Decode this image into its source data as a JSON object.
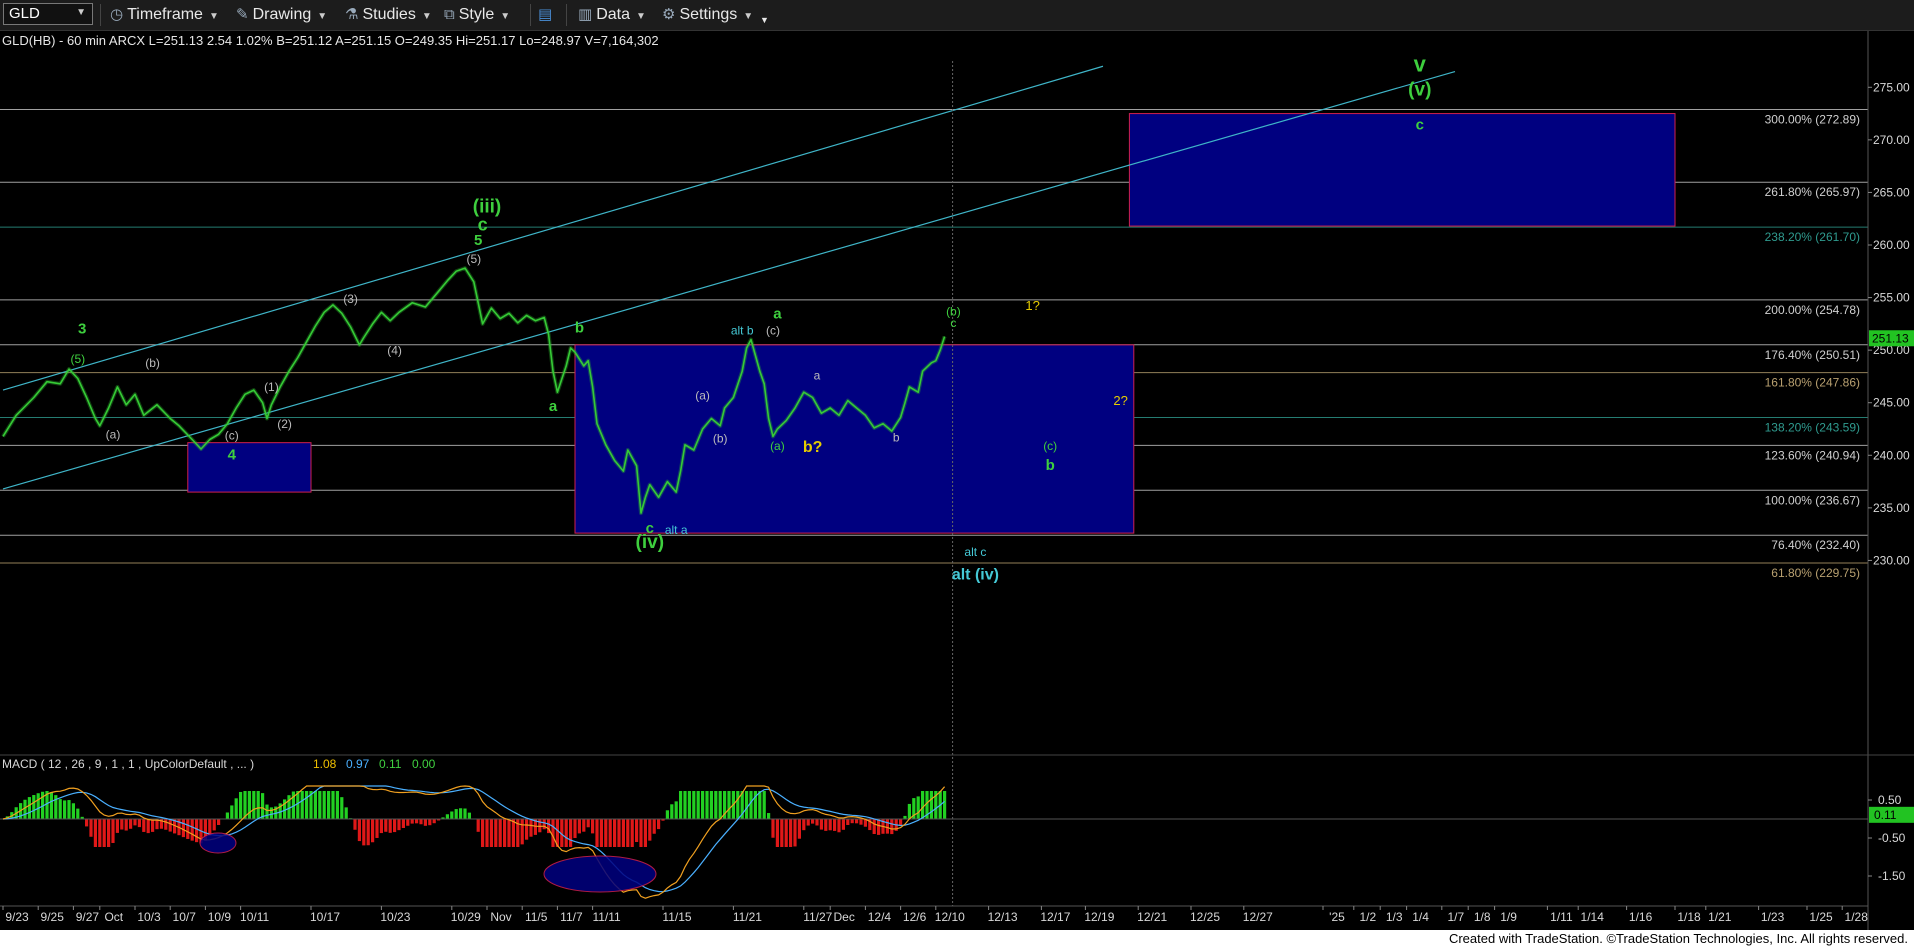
{
  "toolbar": {
    "symbol": "GLD",
    "timeframe_label": "Timeframe",
    "drawing_label": "Drawing",
    "studies_label": "Studies",
    "style_label": "Style",
    "data_label": "Data",
    "settings_label": "Settings"
  },
  "header": {
    "info": "GLD(HB) - 60 min  ARCX  L=251.13  2.54  1.02%  B=251.12  A=251.15  O=249.35  Hi=251.17  Lo=248.97  V=7,164,302"
  },
  "macd": {
    "label": "MACD ( 12 , 26 , 9 , 1 , 1 , UpColorDefault , ... )",
    "values": [
      "1.08",
      "0.97",
      "0.11",
      "0.00"
    ],
    "colors": [
      "#f0c000",
      "#4ab0ff",
      "#40d040",
      "#40d040"
    ],
    "axis_ticks": [
      {
        "value": 0.5,
        "label": "0.50"
      },
      {
        "value": -0.5,
        "label": "-0.50"
      },
      {
        "value": -1.5,
        "label": "-1.50"
      }
    ],
    "current_value_label": "0.11"
  },
  "chart_data": {
    "type": "line",
    "title": "GLD(HB) - 60 min",
    "ylim": [
      225,
      277.5
    ],
    "last_price": 251.13,
    "last_price_label": "251.13",
    "y_ticks": [
      {
        "value": 275,
        "label": "275.00"
      },
      {
        "value": 270,
        "label": "270.00"
      },
      {
        "value": 265,
        "label": "265.00"
      },
      {
        "value": 260,
        "label": "260.00"
      },
      {
        "value": 255,
        "label": "255.00"
      },
      {
        "value": 250,
        "label": "250.00"
      },
      {
        "value": 245,
        "label": "245.00"
      },
      {
        "value": 240,
        "label": "240.00"
      },
      {
        "value": 235,
        "label": "235.00"
      },
      {
        "value": 230,
        "label": "230.00"
      }
    ],
    "x_ticks": [
      {
        "i": 0,
        "label": "9/23"
      },
      {
        "i": 8,
        "label": "9/25"
      },
      {
        "i": 16,
        "label": "9/27"
      },
      {
        "i": 22,
        "label": "Oct"
      },
      {
        "i": 30,
        "label": "10/3"
      },
      {
        "i": 38,
        "label": "10/7"
      },
      {
        "i": 46,
        "label": "10/9"
      },
      {
        "i": 54,
        "label": "10/11"
      },
      {
        "i": 70,
        "label": "10/17"
      },
      {
        "i": 86,
        "label": "10/23"
      },
      {
        "i": 102,
        "label": "10/29"
      },
      {
        "i": 110,
        "label": "Nov"
      },
      {
        "i": 118,
        "label": "11/5"
      },
      {
        "i": 126,
        "label": "11/7"
      },
      {
        "i": 134,
        "label": "11/11"
      },
      {
        "i": 150,
        "label": "11/15"
      },
      {
        "i": 166,
        "label": "11/21"
      },
      {
        "i": 182,
        "label": "11/27"
      },
      {
        "i": 188,
        "label": "Dec"
      },
      {
        "i": 196,
        "label": "12/4"
      },
      {
        "i": 204,
        "label": "12/6"
      },
      {
        "i": 212,
        "label": "12/10"
      },
      {
        "i": 224,
        "label": "12/13"
      },
      {
        "i": 236,
        "label": "12/17"
      },
      {
        "i": 246,
        "label": "12/19"
      },
      {
        "i": 258,
        "label": "12/21"
      },
      {
        "i": 270,
        "label": "12/25"
      },
      {
        "i": 282,
        "label": "12/27"
      },
      {
        "i": 300,
        "label": "'25"
      },
      {
        "i": 307,
        "label": "1/2"
      },
      {
        "i": 313,
        "label": "1/3"
      },
      {
        "i": 319,
        "label": "1/4"
      },
      {
        "i": 327,
        "label": "1/7"
      },
      {
        "i": 333,
        "label": "1/8"
      },
      {
        "i": 339,
        "label": "1/9"
      },
      {
        "i": 351,
        "label": "1/11"
      },
      {
        "i": 358,
        "label": "1/14"
      },
      {
        "i": 369,
        "label": "1/16"
      },
      {
        "i": 380,
        "label": "1/18"
      },
      {
        "i": 387,
        "label": "1/21"
      },
      {
        "i": 399,
        "label": "1/23"
      },
      {
        "i": 410,
        "label": "1/25"
      },
      {
        "i": 418,
        "label": "1/28"
      }
    ],
    "price_path": [
      [
        0,
        241.8
      ],
      [
        3,
        243.8
      ],
      [
        7,
        245.5
      ],
      [
        10,
        247.0
      ],
      [
        13,
        246.8
      ],
      [
        15,
        248.2
      ],
      [
        17,
        247.3
      ],
      [
        19,
        245.5
      ],
      [
        21,
        243.5
      ],
      [
        22,
        242.8
      ],
      [
        24,
        244.5
      ],
      [
        26,
        246.5
      ],
      [
        28,
        244.8
      ],
      [
        30,
        245.8
      ],
      [
        32,
        243.8
      ],
      [
        35,
        244.8
      ],
      [
        38,
        243.5
      ],
      [
        40,
        242.8
      ],
      [
        43,
        241.5
      ],
      [
        45,
        240.6
      ],
      [
        47,
        241.5
      ],
      [
        49,
        242.0
      ],
      [
        51,
        243.0
      ],
      [
        53,
        244.5
      ],
      [
        55,
        245.8
      ],
      [
        57,
        246.2
      ],
      [
        59,
        245.0
      ],
      [
        60,
        243.5
      ],
      [
        61,
        244.8
      ],
      [
        63,
        246.5
      ],
      [
        65,
        248.0
      ],
      [
        67,
        249.3
      ],
      [
        69,
        250.8
      ],
      [
        71,
        252.3
      ],
      [
        73,
        253.6
      ],
      [
        75,
        254.3
      ],
      [
        77,
        253.5
      ],
      [
        79,
        252.2
      ],
      [
        81,
        250.5
      ],
      [
        82,
        251.2
      ],
      [
        84,
        252.5
      ],
      [
        86,
        253.6
      ],
      [
        88,
        252.8
      ],
      [
        90,
        253.6
      ],
      [
        93,
        254.5
      ],
      [
        96,
        254.1
      ],
      [
        99,
        255.6
      ],
      [
        101,
        256.6
      ],
      [
        103,
        257.5
      ],
      [
        105,
        257.8
      ],
      [
        107,
        256.5
      ],
      [
        108,
        254.5
      ],
      [
        109,
        252.5
      ],
      [
        111,
        254.0
      ],
      [
        113,
        253.0
      ],
      [
        115,
        253.5
      ],
      [
        117,
        252.6
      ],
      [
        119,
        253.3
      ],
      [
        121,
        252.8
      ],
      [
        123,
        253.1
      ],
      [
        124,
        251.5
      ],
      [
        125,
        248.0
      ],
      [
        126,
        246.0
      ],
      [
        128,
        248.5
      ],
      [
        129,
        250.2
      ],
      [
        130,
        249.8
      ],
      [
        132,
        248.5
      ],
      [
        133,
        249.0
      ],
      [
        134,
        246.5
      ],
      [
        135,
        243.0
      ],
      [
        137,
        241.0
      ],
      [
        139,
        239.5
      ],
      [
        141,
        238.5
      ],
      [
        142,
        240.5
      ],
      [
        144,
        239.0
      ],
      [
        145,
        234.5
      ],
      [
        146,
        236.0
      ],
      [
        147,
        237.2
      ],
      [
        149,
        236.0
      ],
      [
        151,
        237.5
      ],
      [
        153,
        236.5
      ],
      [
        154,
        238.5
      ],
      [
        155,
        241.0
      ],
      [
        157,
        240.5
      ],
      [
        159,
        242.5
      ],
      [
        161,
        243.5
      ],
      [
        163,
        242.8
      ],
      [
        164,
        244.5
      ],
      [
        166,
        245.5
      ],
      [
        168,
        248.0
      ],
      [
        169,
        250.2
      ],
      [
        170,
        251.0
      ],
      [
        171,
        249.5
      ],
      [
        172,
        248.0
      ],
      [
        173,
        246.8
      ],
      [
        174,
        243.5
      ],
      [
        175,
        241.8
      ],
      [
        176,
        242.5
      ],
      [
        178,
        243.3
      ],
      [
        180,
        244.5
      ],
      [
        182,
        246.0
      ],
      [
        184,
        245.5
      ],
      [
        186,
        244.0
      ],
      [
        188,
        244.5
      ],
      [
        190,
        243.8
      ],
      [
        192,
        245.2
      ],
      [
        194,
        244.5
      ],
      [
        196,
        243.8
      ],
      [
        198,
        242.6
      ],
      [
        200,
        243.0
      ],
      [
        202,
        242.3
      ],
      [
        204,
        243.6
      ],
      [
        205,
        245.0
      ],
      [
        206,
        246.5
      ],
      [
        208,
        246.0
      ],
      [
        209,
        248.0
      ],
      [
        211,
        248.8
      ],
      [
        212,
        249.0
      ],
      [
        213,
        250.0
      ],
      [
        214,
        251.3
      ]
    ],
    "channel_lines": [
      {
        "i1": 0,
        "v1": 246.2,
        "i2": 250,
        "v2": 277.0
      },
      {
        "i1": 0,
        "v1": 236.8,
        "i2": 330,
        "v2": 276.5
      }
    ],
    "fib_levels": [
      {
        "value": 272.89,
        "label": "300.00% (272.89)",
        "color": "#c8c8c8"
      },
      {
        "value": 265.97,
        "label": "261.80% (265.97)",
        "color": "#c8c8c8"
      },
      {
        "value": 261.7,
        "label": "238.20% (261.70)",
        "color": "#2f9b8f"
      },
      {
        "value": 254.78,
        "label": "200.00% (254.78)",
        "color": "#c8c8c8"
      },
      {
        "value": 250.51,
        "label": "176.40% (250.51)",
        "color": "#c8c8c8"
      },
      {
        "value": 247.86,
        "label": "161.80% (247.86)",
        "color": "#b8a070"
      },
      {
        "value": 243.59,
        "label": "138.20% (243.59)",
        "color": "#2f9b8f"
      },
      {
        "value": 240.94,
        "label": "123.60% (240.94)",
        "color": "#c8c8c8"
      },
      {
        "value": 236.67,
        "label": "100.00% (236.67)",
        "color": "#c8c8c8"
      },
      {
        "value": 232.4,
        "label": "76.40% (232.40)",
        "color": "#c8c8c8"
      },
      {
        "value": 229.75,
        "label": "61.80% (229.75)",
        "color": "#b8a070"
      }
    ],
    "target_boxes": [
      {
        "i1": 42,
        "i2": 70,
        "top": 241.2,
        "bottom": 236.5
      },
      {
        "i1": 130,
        "i2": 257,
        "top": 250.5,
        "bottom": 232.6
      },
      {
        "i1": 256,
        "i2": 380,
        "top": 272.5,
        "bottom": 261.8
      }
    ],
    "annotations": [
      {
        "i": 18,
        "v": 251.6,
        "text": "3",
        "color": "#3ecf3e",
        "size": 15
      },
      {
        "i": 17,
        "v": 248.8,
        "text": "(5)",
        "color": "#3ecf3e",
        "size": 12
      },
      {
        "i": 34,
        "v": 248.4,
        "text": "(b)",
        "color": "#bbbbbb",
        "size": 12
      },
      {
        "i": 25,
        "v": 241.6,
        "text": "(a)",
        "color": "#bbbbbb",
        "size": 12
      },
      {
        "i": 52,
        "v": 241.5,
        "text": "(c)",
        "color": "#bbbbbb",
        "size": 12
      },
      {
        "i": 52,
        "v": 239.6,
        "text": "4",
        "color": "#3ecf3e",
        "size": 15
      },
      {
        "i": 61,
        "v": 246.1,
        "text": "(1)",
        "color": "#bbbbbb",
        "size": 12
      },
      {
        "i": 64,
        "v": 242.6,
        "text": "(2)",
        "color": "#bbbbbb",
        "size": 12
      },
      {
        "i": 79,
        "v": 254.5,
        "text": "(3)",
        "color": "#bbbbbb",
        "size": 12
      },
      {
        "i": 89,
        "v": 249.6,
        "text": "(4)",
        "color": "#bbbbbb",
        "size": 12
      },
      {
        "i": 107,
        "v": 258.3,
        "text": "(5)",
        "color": "#bbbbbb",
        "size": 12
      },
      {
        "i": 108,
        "v": 260.0,
        "text": "5",
        "color": "#3ecf3e",
        "size": 15
      },
      {
        "i": 109,
        "v": 261.4,
        "text": "c",
        "color": "#3ecf3e",
        "size": 18
      },
      {
        "i": 110,
        "v": 263.1,
        "text": "(iii)",
        "color": "#3ecf3e",
        "size": 19
      },
      {
        "i": 131,
        "v": 251.7,
        "text": "b",
        "color": "#3ecf3e",
        "size": 15
      },
      {
        "i": 125,
        "v": 244.2,
        "text": "a",
        "color": "#3ecf3e",
        "size": 15
      },
      {
        "i": 147,
        "v": 232.6,
        "text": "c",
        "color": "#3ecf3e",
        "size": 15
      },
      {
        "i": 147,
        "v": 231.2,
        "text": "(iv)",
        "color": "#3ecf3e",
        "size": 19
      },
      {
        "i": 153,
        "v": 232.5,
        "text": "alt a",
        "color": "#45c9d6",
        "size": 12
      },
      {
        "i": 159,
        "v": 245.3,
        "text": "(a)",
        "color": "#bbbbbb",
        "size": 12
      },
      {
        "i": 163,
        "v": 241.2,
        "text": "(b)",
        "color": "#bbbbbb",
        "size": 12
      },
      {
        "i": 168,
        "v": 251.5,
        "text": "alt b",
        "color": "#45c9d6",
        "size": 12
      },
      {
        "i": 175,
        "v": 251.5,
        "text": "(c)",
        "color": "#bbbbbb",
        "size": 12
      },
      {
        "i": 176,
        "v": 253.0,
        "text": "a",
        "color": "#3ecf3e",
        "size": 15
      },
      {
        "i": 176,
        "v": 240.5,
        "text": "(a)",
        "color": "#3ecf3e",
        "size": 12
      },
      {
        "i": 184,
        "v": 240.3,
        "text": "b?",
        "color": "#e6cc00",
        "size": 16
      },
      {
        "i": 185,
        "v": 247.2,
        "text": "a",
        "color": "#bbbbbb",
        "size": 12
      },
      {
        "i": 203,
        "v": 241.3,
        "text": "b",
        "color": "#bbbbbb",
        "size": 12
      },
      {
        "i": 216,
        "v": 253.3,
        "text": "(b)",
        "color": "#3ecf3e",
        "size": 12
      },
      {
        "i": 216,
        "v": 252.2,
        "text": "c",
        "color": "#3ecf3e",
        "size": 12
      },
      {
        "i": 234,
        "v": 253.8,
        "text": "1?",
        "color": "#e6cc00",
        "size": 13
      },
      {
        "i": 254,
        "v": 244.8,
        "text": "2?",
        "color": "#e6cc00",
        "size": 13
      },
      {
        "i": 238,
        "v": 240.5,
        "text": "(c)",
        "color": "#3ecf3e",
        "size": 12
      },
      {
        "i": 238,
        "v": 238.6,
        "text": "b",
        "color": "#3ecf3e",
        "size": 15
      },
      {
        "i": 221,
        "v": 230.4,
        "text": "alt c",
        "color": "#45c9d6",
        "size": 12
      },
      {
        "i": 221,
        "v": 228.2,
        "text": "alt (iv)",
        "color": "#45c9d6",
        "size": 16
      },
      {
        "i": 322,
        "v": 276.5,
        "text": "v",
        "color": "#3ecf3e",
        "size": 22
      },
      {
        "i": 322,
        "v": 274.2,
        "text": "(v)",
        "color": "#3ecf3e",
        "size": 19
      },
      {
        "i": 322,
        "v": 271.0,
        "text": "c",
        "color": "#3ecf3e",
        "size": 15
      }
    ]
  },
  "footer": {
    "text": "Created with TradeStation. ©TradeStation Technologies, Inc. All rights reserved."
  }
}
